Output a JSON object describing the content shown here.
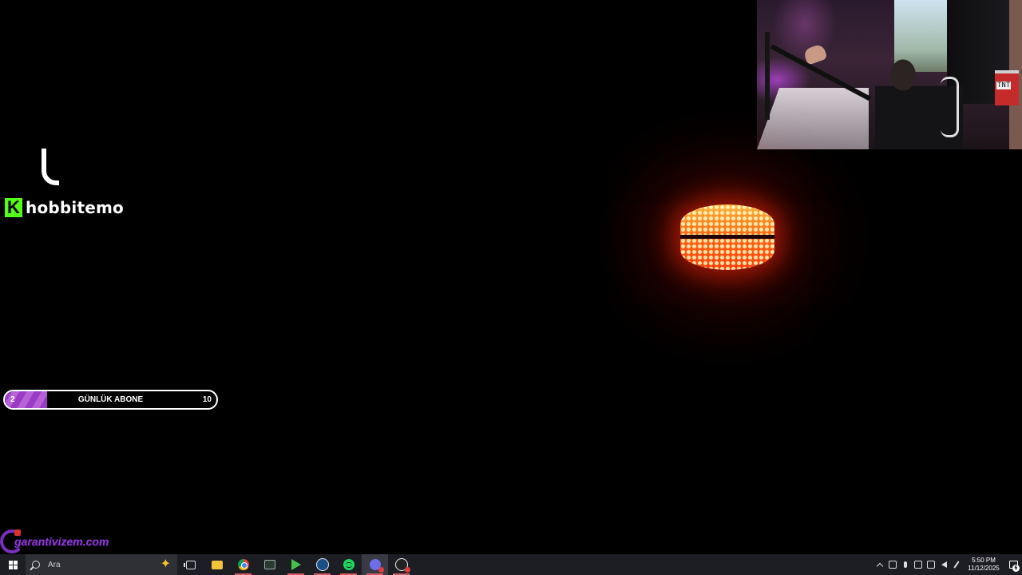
{
  "overlay": {
    "streamer_name": "hobbitemo",
    "kick_logo_letter": "K",
    "watermark_text": "garantivizem.com"
  },
  "goal": {
    "current": "2",
    "label": "GÜNLÜK ABONE",
    "target": "10",
    "progress_fraction": 0.2
  },
  "webcam": {
    "sign_text": "TNT"
  },
  "taskbar": {
    "search_placeholder": "Ara",
    "apps": [
      {
        "name": "task-view",
        "icon": "task-view-icon"
      },
      {
        "name": "file-explorer",
        "icon": "folder-icon"
      },
      {
        "name": "chrome",
        "icon": "chrome-icon"
      },
      {
        "name": "xbox-excel-app",
        "icon": "app-icon"
      },
      {
        "name": "play-app",
        "icon": "play-icon"
      },
      {
        "name": "steam",
        "icon": "steam-icon"
      },
      {
        "name": "spotify",
        "icon": "spotify-icon"
      },
      {
        "name": "discord",
        "icon": "discord-icon"
      },
      {
        "name": "obs",
        "icon": "obs-icon"
      }
    ],
    "time": "5:50 PM",
    "date": "11/12/2025",
    "notification_count": "6"
  },
  "colors": {
    "kick_green": "#53fc18",
    "goal_purple": "#9b3dc4",
    "taskbar_bg": "#1d1d24"
  }
}
